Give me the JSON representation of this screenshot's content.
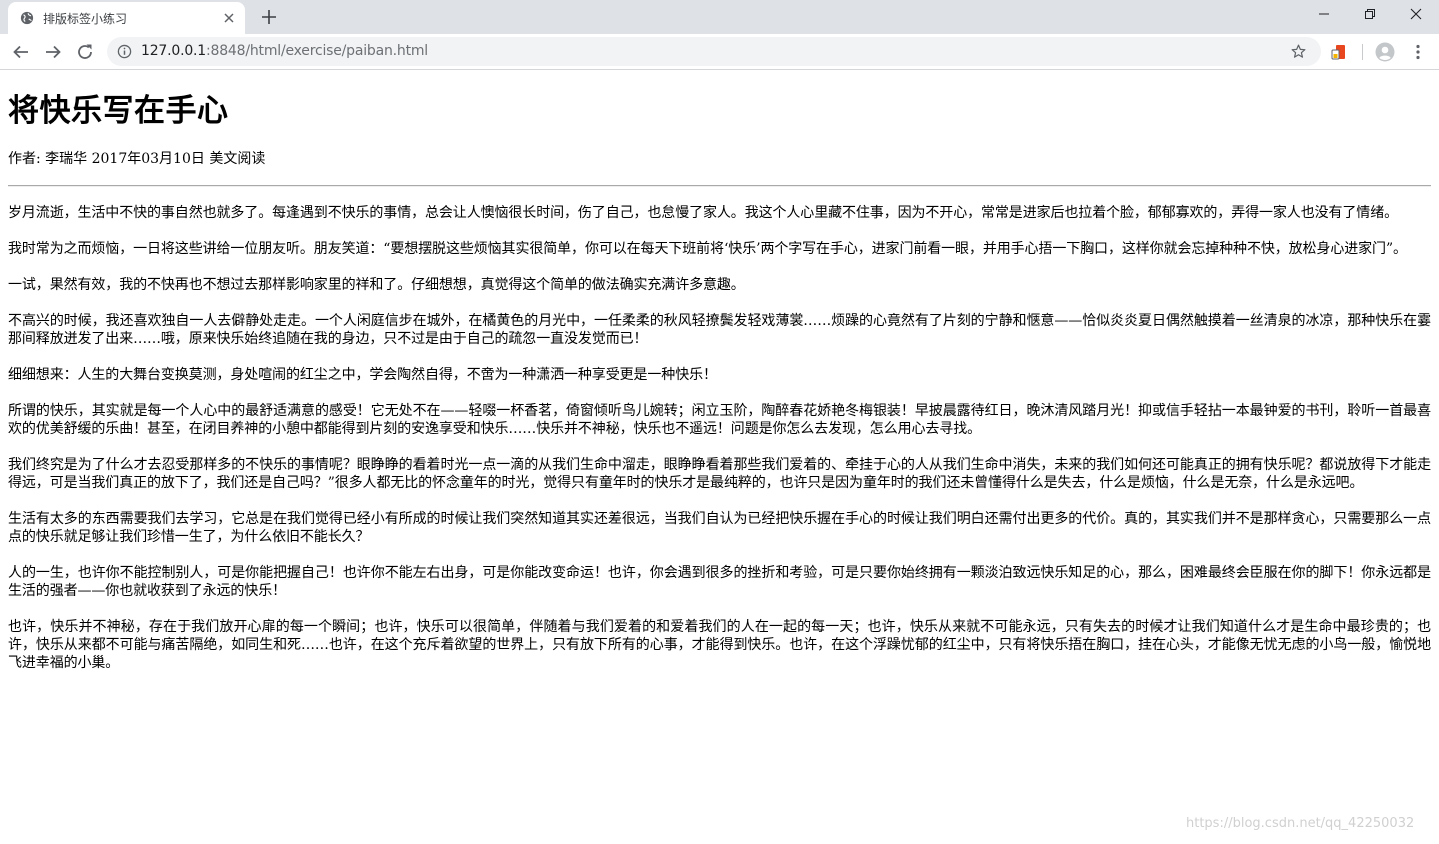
{
  "browser": {
    "tab": {
      "title": "排版标签小练习",
      "favicon": "globe-icon"
    },
    "address": {
      "host": "127.0.0.1",
      "path": ":8848/html/exercise/paiban.html"
    },
    "colors": {
      "tabstrip": "#dee1e6",
      "omnibox": "#f1f3f4",
      "icon": "#5f6368",
      "extension": "#e8461f"
    }
  },
  "article": {
    "title": "将快乐写在手心",
    "byline": "作者: 李瑞华 2017年03月10日 美文阅读",
    "paragraphs": [
      "岁月流逝，生活中不快的事自然也就多了。每逢遇到不快乐的事情，总会让人懊恼很长时间，伤了自己，也怠慢了家人。我这个人心里藏不住事，因为不开心，常常是进家后也拉着个脸，郁郁寡欢的，弄得一家人也没有了情绪。",
      "我时常为之而烦恼，一日将这些讲给一位朋友听。朋友笑道：“要想摆脱这些烦恼其实很简单，你可以在每天下班前将‘快乐’两个字写在手心，进家门前看一眼，并用手心捂一下胸口，这样你就会忘掉种种不快，放松身心进家门”。",
      "一试，果然有效，我的不快再也不想过去那样影响家里的祥和了。仔细想想，真觉得这个简单的做法确实充满许多意趣。",
      "不高兴的时候，我还喜欢独自一人去僻静处走走。一个人闲庭信步在城外，在橘黄色的月光中，一任柔柔的秋风轻撩鬓发轻戏薄裳……烦躁的心竟然有了片刻的宁静和惬意——恰似炎炎夏日偶然触摸着一丝清泉的冰凉，那种快乐在霎那间释放迸发了出来……哦，原来快乐始终追随在我的身边，只不过是由于自己的疏忽一直没发觉而已！",
      "细细想来：人生的大舞台变换莫测，身处喧闹的红尘之中，学会陶然自得，不啻为一种潇洒一种享受更是一种快乐！",
      "所谓的快乐，其实就是每一个人心中的最舒适满意的感受！它无处不在——轻啜一杯香茗，倚窗倾听鸟儿婉转；闲立玉阶，陶醉春花娇艳冬梅银装！早披晨露待红日，晚沐清风踏月光！抑或信手轻拈一本最钟爱的书刊，聆听一首最喜欢的优美舒缓的乐曲！甚至，在闭目养神的小憩中都能得到片刻的安逸享受和快乐……快乐并不神秘，快乐也不遥远！问题是你怎么去发现，怎么用心去寻找。",
      "我们终究是为了什么才去忍受那样多的不快乐的事情呢？眼睁睁的看着时光一点一滴的从我们生命中溜走，眼睁睁看着那些我们爱着的、牵挂于心的人从我们生命中消失，未来的我们如何还可能真正的拥有快乐呢？都说放得下才能走得远，可是当我们真正的放下了，我们还是自己吗？”很多人都无比的怀念童年的时光，觉得只有童年时的快乐才是最纯粹的，也许只是因为童年时的我们还未曾懂得什么是失去，什么是烦恼，什么是无奈，什么是永远吧。",
      "生活有太多的东西需要我们去学习，它总是在我们觉得已经小有所成的时候让我们突然知道其实还差很远，当我们自认为已经把快乐握在手心的时候让我们明白还需付出更多的代价。真的，其实我们并不是那样贪心，只需要那么一点点的快乐就足够让我们珍惜一生了，为什么依旧不能长久？",
      "人的一生，也许你不能控制别人，可是你能把握自己！也许你不能左右出身，可是你能改变命运！也许，你会遇到很多的挫折和考验，可是只要你始终拥有一颗淡泊致远快乐知足的心，那么，困难最终会臣服在你的脚下！你永远都是生活的强者——你也就收获到了永远的快乐！",
      "也许，快乐并不神秘，存在于我们放开心扉的每一个瞬间；也许，快乐可以很简单，伴随着与我们爱着的和爱着我们的人在一起的每一天；也许，快乐从来就不可能永远，只有失去的时候才让我们知道什么才是生命中最珍贵的；也许，快乐从来都不可能与痛苦隔绝，如同生和死……也许，在这个充斥着欲望的世界上，只有放下所有的心事，才能得到快乐。也许，在这个浮躁忧郁的红尘中，只有将快乐捂在胸口，挂在心头，才能像无忧无虑的小鸟一般，愉悦地飞进幸福的小巢。"
    ]
  },
  "watermark": "https://blog.csdn.net/qq_42250032"
}
